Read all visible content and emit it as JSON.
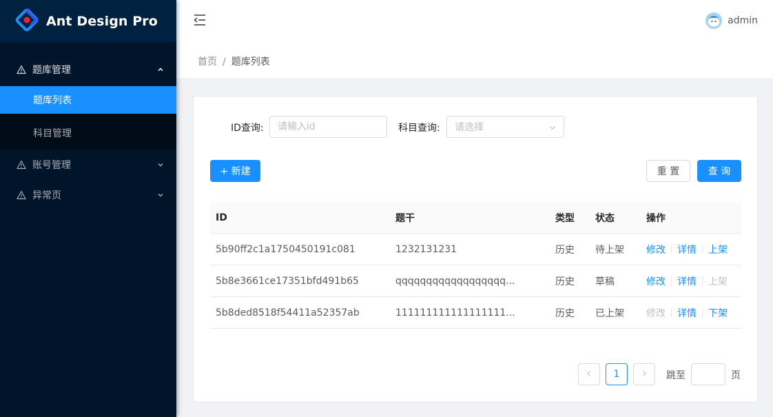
{
  "app": {
    "title": "Ant Design Pro"
  },
  "sidebar": {
    "groups": [
      {
        "label": "题库管理",
        "expanded": true,
        "items": [
          {
            "label": "题库列表",
            "active": true
          },
          {
            "label": "科目管理",
            "active": false
          }
        ]
      },
      {
        "label": "账号管理",
        "expanded": false
      },
      {
        "label": "异常页",
        "expanded": false
      }
    ]
  },
  "header": {
    "user_name": "admin"
  },
  "breadcrumb": {
    "home": "首页",
    "separator": "/",
    "current": "题库列表"
  },
  "filters": {
    "id_label": "ID查询:",
    "id_placeholder": "请输入id",
    "subject_label": "科目查询:",
    "subject_placeholder": "请选择"
  },
  "actions": {
    "create_label": "+ 新建",
    "reset_label": "重 置",
    "search_label": "查 询"
  },
  "table": {
    "columns": [
      "ID",
      "题干",
      "类型",
      "状态",
      "操作"
    ],
    "rows": [
      {
        "id": "5b90ff2c1a1750450191c081",
        "title": "1232131231",
        "type": "历史",
        "status": "待上架",
        "ops": [
          {
            "label": "修改",
            "disabled": false
          },
          {
            "label": "详情",
            "disabled": false
          },
          {
            "label": "上架",
            "disabled": false
          }
        ]
      },
      {
        "id": "5b8e3661ce17351bfd491b65",
        "title": "qqqqqqqqqqqqqqqqqq...",
        "type": "历史",
        "status": "草稿",
        "ops": [
          {
            "label": "修改",
            "disabled": false
          },
          {
            "label": "详情",
            "disabled": false
          },
          {
            "label": "上架",
            "disabled": true
          }
        ]
      },
      {
        "id": "5b8ded8518f54411a52357ab",
        "title": "111111111111111111...",
        "type": "历史",
        "status": "已上架",
        "ops": [
          {
            "label": "修改",
            "disabled": true
          },
          {
            "label": "详情",
            "disabled": false
          },
          {
            "label": "下架",
            "disabled": false
          }
        ]
      }
    ]
  },
  "pagination": {
    "current_page": "1",
    "jump_label": "跳至",
    "page_suffix": "页"
  },
  "colors": {
    "primary": "#1890ff",
    "sider_bg": "#001529",
    "disabled_text": "rgba(0,0,0,0.25)"
  }
}
